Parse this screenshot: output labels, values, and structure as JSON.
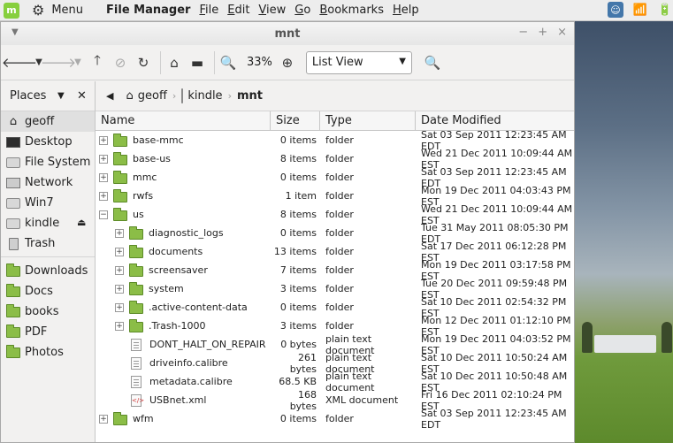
{
  "panel": {
    "mint_glyph": "m",
    "menu_label": "Menu",
    "app_title": "File Manager",
    "menus": [
      {
        "letter": "F",
        "rest": "ile"
      },
      {
        "letter": "E",
        "rest": "dit"
      },
      {
        "letter": "V",
        "rest": "iew"
      },
      {
        "letter": "G",
        "rest": "o"
      },
      {
        "letter": "B",
        "rest": "ookmarks"
      },
      {
        "letter": "H",
        "rest": "elp"
      }
    ]
  },
  "window": {
    "title": "mnt",
    "zoom": "33%",
    "view_mode": "List View"
  },
  "sidebar": {
    "header": "Places",
    "items": [
      {
        "label": "geoff",
        "icon": "home-icon"
      },
      {
        "label": "Desktop",
        "icon": "desktop-icon"
      },
      {
        "label": "File System",
        "icon": "drive-icon"
      },
      {
        "label": "Network",
        "icon": "network-icon"
      },
      {
        "label": "Win7",
        "icon": "drive-icon"
      },
      {
        "label": "kindle",
        "icon": "drive-icon"
      },
      {
        "label": "Trash",
        "icon": "trash-icon"
      }
    ],
    "bookmarks": [
      {
        "label": "Downloads",
        "icon": "folder-icon"
      },
      {
        "label": "Docs",
        "icon": "folder-icon"
      },
      {
        "label": "books",
        "icon": "folder-icon"
      },
      {
        "label": "PDF",
        "icon": "folder-icon"
      },
      {
        "label": "Photos",
        "icon": "folder-icon"
      }
    ]
  },
  "pathbar": {
    "crumbs": [
      "geoff",
      "kindle",
      "mnt"
    ]
  },
  "columns": {
    "name": "Name",
    "size": "Size",
    "type": "Type",
    "date": "Date Modified"
  },
  "rows": [
    {
      "name": "base-mmc",
      "size": "0 items",
      "type": "folder",
      "date": "Sat 03 Sep 2011 12:23:45 AM EDT",
      "level": 0,
      "kind": "folder",
      "expander": "+"
    },
    {
      "name": "base-us",
      "size": "8 items",
      "type": "folder",
      "date": "Wed 21 Dec 2011 10:09:44 AM EST",
      "level": 0,
      "kind": "folder",
      "expander": "+"
    },
    {
      "name": "mmc",
      "size": "0 items",
      "type": "folder",
      "date": "Sat 03 Sep 2011 12:23:45 AM EDT",
      "level": 0,
      "kind": "folder",
      "expander": "+"
    },
    {
      "name": "rwfs",
      "size": "1 item",
      "type": "folder",
      "date": "Mon 19 Dec 2011 04:03:43 PM EST",
      "level": 0,
      "kind": "folder",
      "expander": "+"
    },
    {
      "name": "us",
      "size": "8 items",
      "type": "folder",
      "date": "Wed 21 Dec 2011 10:09:44 AM EST",
      "level": 0,
      "kind": "folder",
      "expander": "−"
    },
    {
      "name": "diagnostic_logs",
      "size": "0 items",
      "type": "folder",
      "date": "Tue 31 May 2011 08:05:30 PM EDT",
      "level": 1,
      "kind": "folder",
      "expander": "+"
    },
    {
      "name": "documents",
      "size": "13 items",
      "type": "folder",
      "date": "Sat 17 Dec 2011 06:12:28 PM EST",
      "level": 1,
      "kind": "folder",
      "expander": "+"
    },
    {
      "name": "screensaver",
      "size": "7 items",
      "type": "folder",
      "date": "Mon 19 Dec 2011 03:17:58 PM EST",
      "level": 1,
      "kind": "folder",
      "expander": "+"
    },
    {
      "name": "system",
      "size": "3 items",
      "type": "folder",
      "date": "Tue 20 Dec 2011 09:59:48 PM EST",
      "level": 1,
      "kind": "folder",
      "expander": "+"
    },
    {
      "name": ".active-content-data",
      "size": "0 items",
      "type": "folder",
      "date": "Sat 10 Dec 2011 02:54:32 PM EST",
      "level": 1,
      "kind": "folder",
      "expander": "+"
    },
    {
      "name": ".Trash-1000",
      "size": "3 items",
      "type": "folder",
      "date": "Mon 12 Dec 2011 01:12:10 PM EST",
      "level": 1,
      "kind": "folder",
      "expander": "+"
    },
    {
      "name": "DONT_HALT_ON_REPAIR",
      "size": "0 bytes",
      "type": "plain text document",
      "date": "Mon 19 Dec 2011 04:03:52 PM EST",
      "level": 1,
      "kind": "text",
      "expander": ""
    },
    {
      "name": "driveinfo.calibre",
      "size": "261 bytes",
      "type": "plain text document",
      "date": "Sat 10 Dec 2011 10:50:24 AM EST",
      "level": 1,
      "kind": "text",
      "expander": ""
    },
    {
      "name": "metadata.calibre",
      "size": "68.5 KB",
      "type": "plain text document",
      "date": "Sat 10 Dec 2011 10:50:48 AM EST",
      "level": 1,
      "kind": "text",
      "expander": ""
    },
    {
      "name": "USBnet.xml",
      "size": "168 bytes",
      "type": "XML document",
      "date": "Fri 16 Dec 2011 02:10:24 PM EST",
      "level": 1,
      "kind": "xml",
      "expander": ""
    },
    {
      "name": "wfm",
      "size": "0 items",
      "type": "folder",
      "date": "Sat 03 Sep 2011 12:23:45 AM EDT",
      "level": 0,
      "kind": "folder",
      "expander": "+"
    }
  ]
}
